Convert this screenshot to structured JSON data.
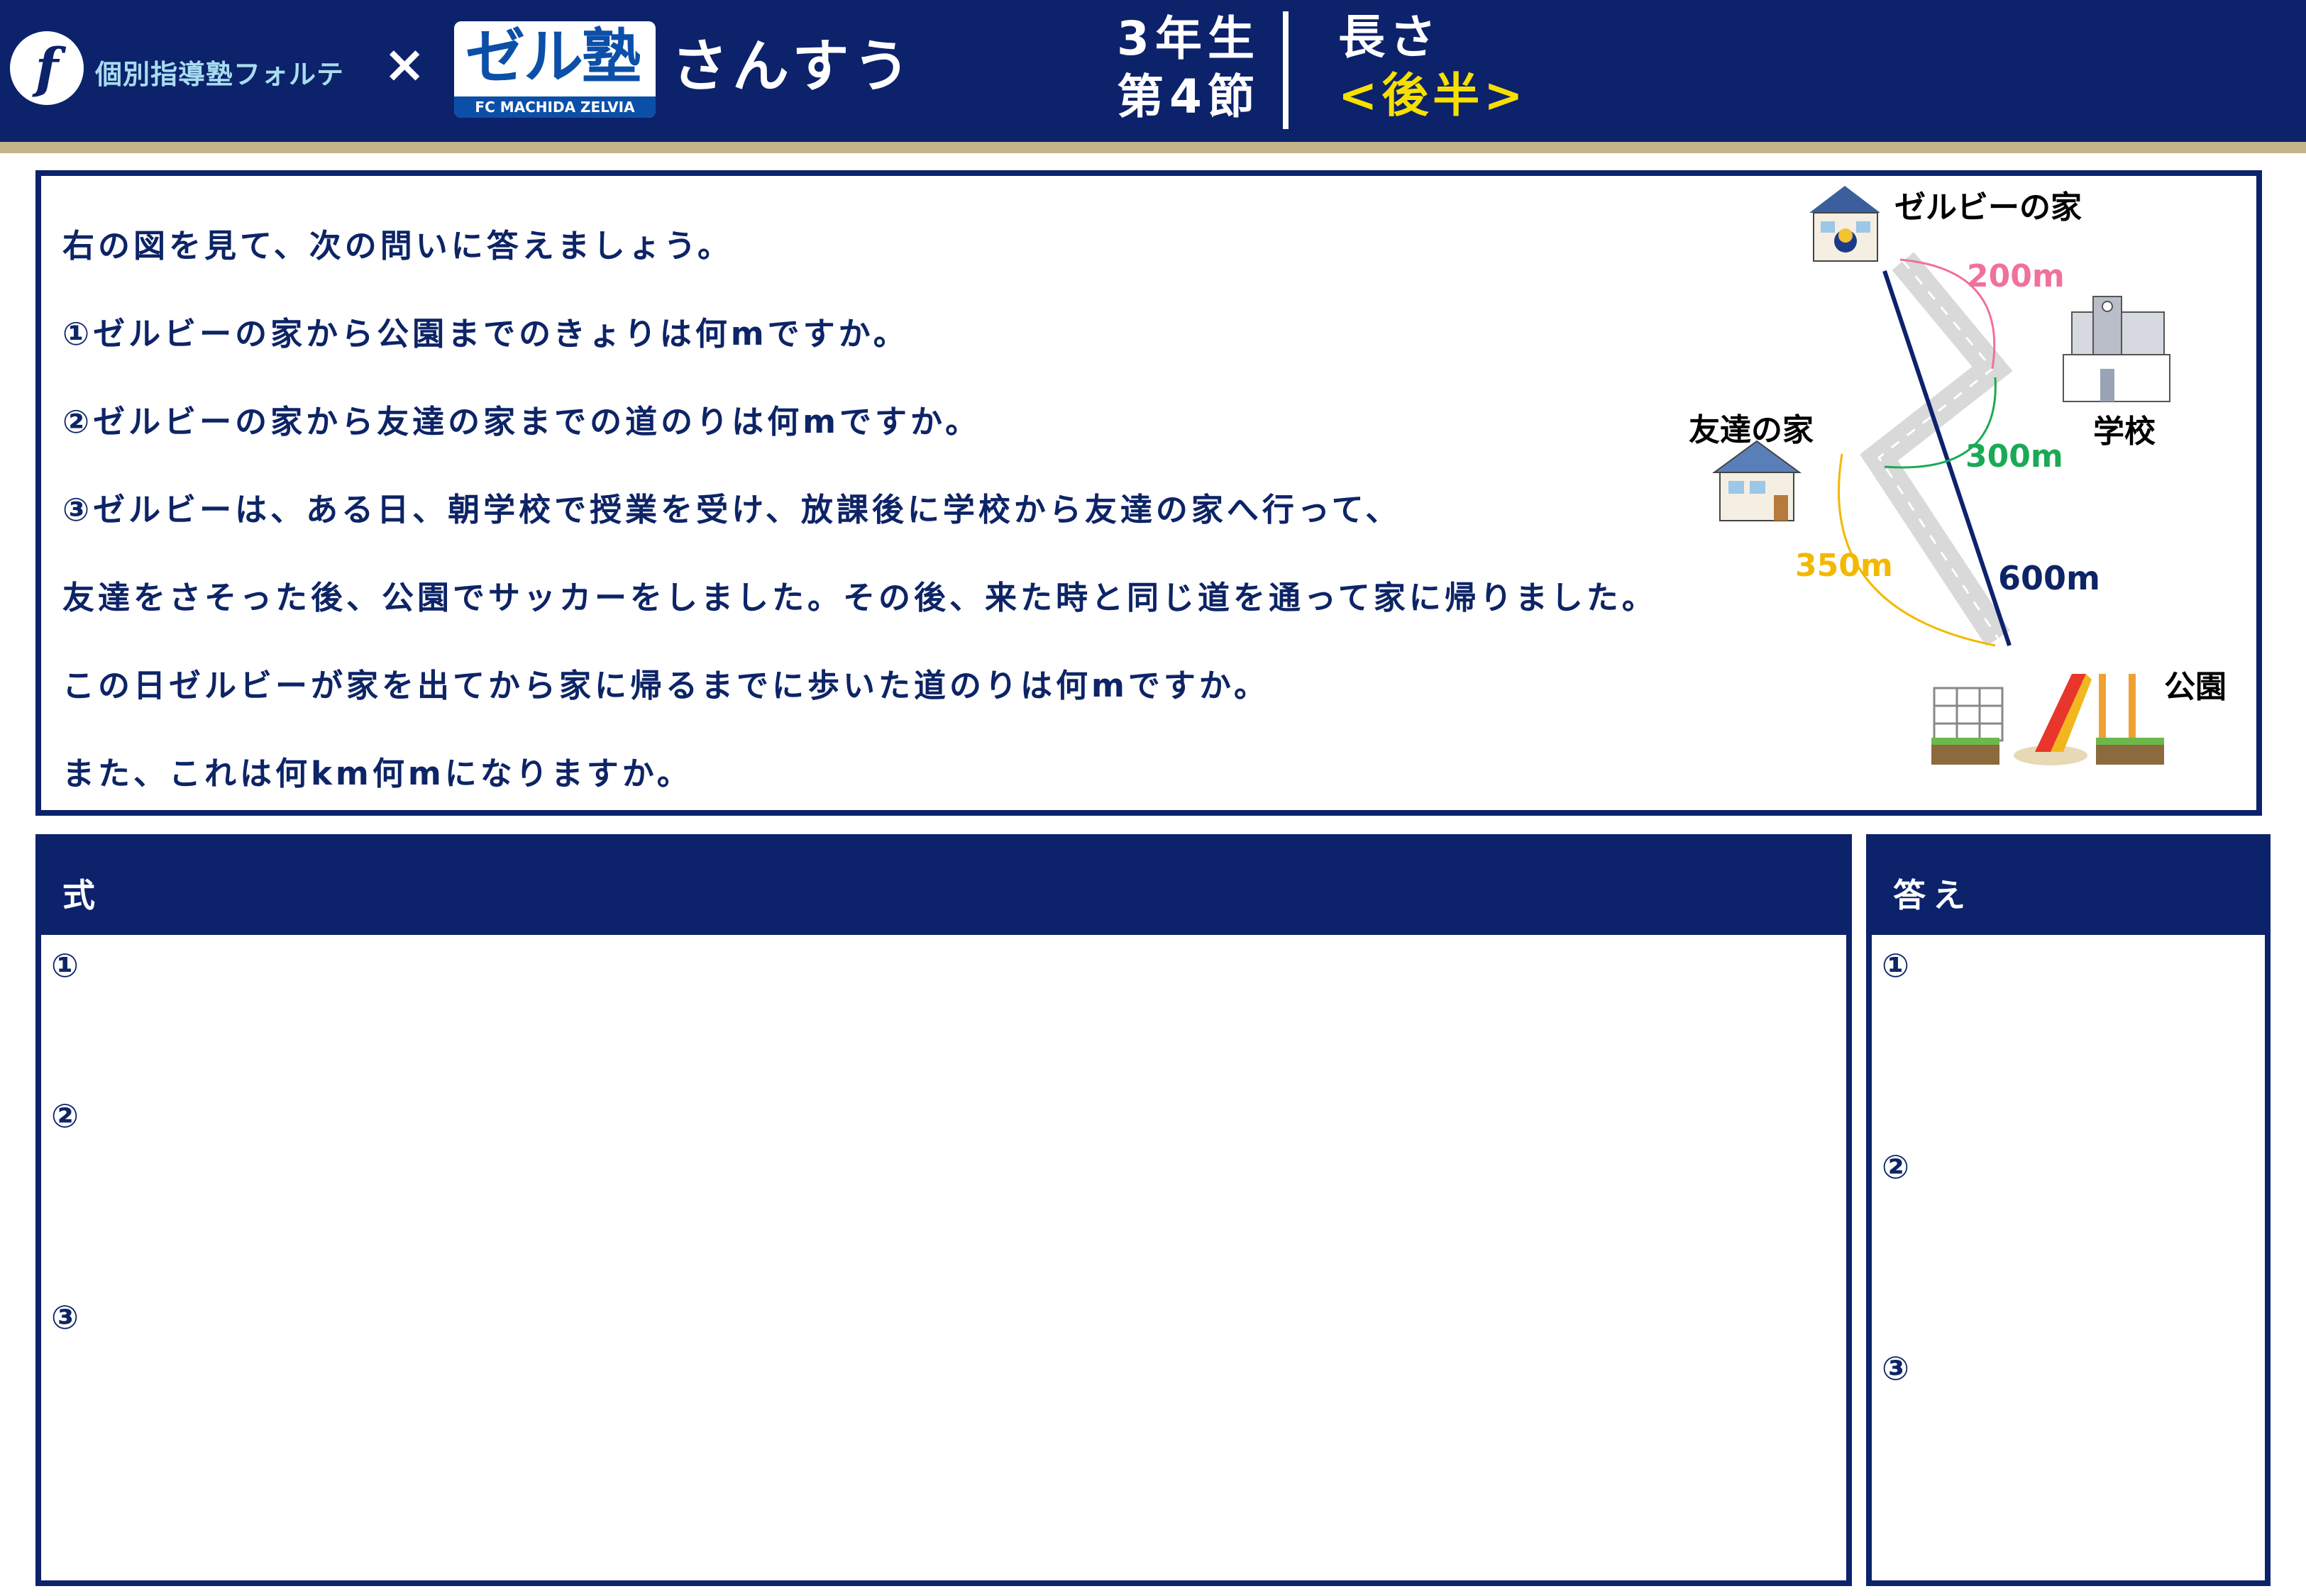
{
  "header": {
    "brand_logo_glyph": "f",
    "brand_name": "個別指導塾フォルテ",
    "cross": "×",
    "zel_logo_main": "ゼル塾",
    "zel_logo_sub": "FC MACHIDA ZELVIA",
    "subject": "さんすう",
    "grade_line1": "3年生",
    "grade_line2": "第4節",
    "topic": "長さ",
    "topic_half": "<後半>"
  },
  "question": {
    "lines": [
      "右の図を見て、次の問いに答えましょう。",
      "①ゼルビーの家から公園までのきょりは何mですか。",
      "②ゼルビーの家から友達の家までの道のりは何mですか。",
      "③ゼルビーは、ある日、朝学校で授業を受け、放課後に学校から友達の家へ行って、",
      "友達をさそった後、公園でサッカーをしました。その後、来た時と同じ道を通って家に帰りました。",
      "この日ゼルビーが家を出てから家に帰るまでに歩いた道のりは何mですか。",
      "また、これは何km何mになりますか。"
    ]
  },
  "diagram": {
    "label_zelby_house": "ゼルビーの家",
    "label_school": "学校",
    "label_friend_house": "友達の家",
    "label_park": "公園",
    "dist_200": "200m",
    "dist_300": "300m",
    "dist_350": "350m",
    "dist_600": "600m",
    "colors": {
      "dist_200": "#f0719a",
      "dist_300": "#1aaa55",
      "dist_350": "#f3b800",
      "dist_600": "#0d2466",
      "road": "#d9d9d9",
      "straight_line": "#0c226b"
    }
  },
  "work_area": {
    "title": "式",
    "marks": [
      "①",
      "②",
      "③"
    ]
  },
  "answer_area": {
    "title": "答え",
    "marks": [
      "①",
      "②",
      "③"
    ]
  },
  "colors": {
    "navy": "#0c226b",
    "gold_stripe": "#c3b48a",
    "topic_half": "#f7e000",
    "brand_text": "#a8dcf0"
  }
}
